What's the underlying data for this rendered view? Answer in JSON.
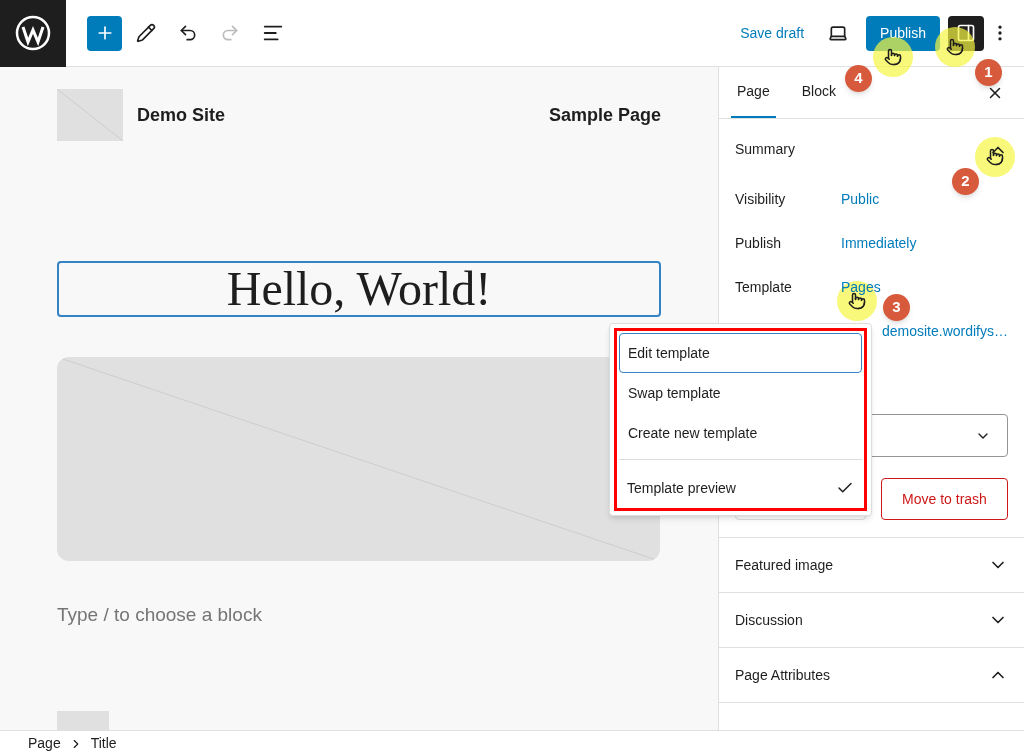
{
  "toolbar": {
    "save_draft": "Save draft",
    "publish": "Publish",
    "settings_selected": true
  },
  "site": {
    "title": "Demo Site",
    "nav": "Sample Page"
  },
  "post": {
    "title": "Hello, World!",
    "placeholder": "Type / to choose a block"
  },
  "sidebar": {
    "tabs": [
      {
        "label": "Page",
        "selected": true
      },
      {
        "label": "Block",
        "selected": false
      }
    ],
    "summary": {
      "title": "Summary",
      "expanded": true,
      "rows": [
        {
          "label": "Visibility",
          "value": "Public"
        },
        {
          "label": "Publish",
          "value": "Immediately"
        },
        {
          "label": "Template",
          "value": "Pages"
        }
      ],
      "url": "demosite.wordifys…",
      "trash": "Move to trash"
    },
    "panels": [
      {
        "title": "Featured image",
        "expanded": false
      },
      {
        "title": "Discussion",
        "expanded": false
      },
      {
        "title": "Page Attributes",
        "expanded": true
      }
    ]
  },
  "menu": {
    "items": [
      {
        "label": "Edit template",
        "selected": true
      },
      {
        "label": "Swap template",
        "selected": false
      },
      {
        "label": "Create new template",
        "selected": false
      }
    ],
    "toggle": {
      "label": "Template preview",
      "checked": true
    }
  },
  "annotations": [
    {
      "label": "1"
    },
    {
      "label": "2"
    },
    {
      "label": "3"
    },
    {
      "label": "4"
    }
  ],
  "breadcrumbs": [
    {
      "label": "Page"
    },
    {
      "label": "Title"
    }
  ]
}
